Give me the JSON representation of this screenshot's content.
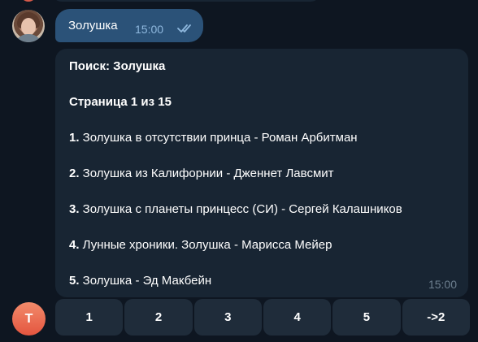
{
  "user_message": {
    "text": "Золушка",
    "time": "15:00"
  },
  "bot_avatar": {
    "letter": "T",
    "color": "#e4553f"
  },
  "bot_message": {
    "title": "Поиск: Золушка",
    "page": "Страница 1 из 15",
    "results": [
      {
        "num": "1.",
        "text": " Золушка в отсутствии принца - Роман Арбитман"
      },
      {
        "num": "2.",
        "text": " Золушка из Калифорнии - Дженнет Лавсмит"
      },
      {
        "num": "3.",
        "text": " Золушка с планеты принцесс (СИ) - Сергей Калашников"
      },
      {
        "num": "4.",
        "text": " Лунные хроники. Золушка - Марисса Мейер"
      },
      {
        "num": "5.",
        "text": " Золушка - Эд Макбейн"
      }
    ],
    "time": "15:00"
  },
  "keyboard": {
    "buttons": [
      "1",
      "2",
      "3",
      "4",
      "5",
      "->2"
    ]
  },
  "colors": {
    "background": "#0e1621",
    "outgoing_bubble": "#2b5278",
    "incoming_bubble": "#182533",
    "keyboard_button": "#1f2c3a"
  }
}
